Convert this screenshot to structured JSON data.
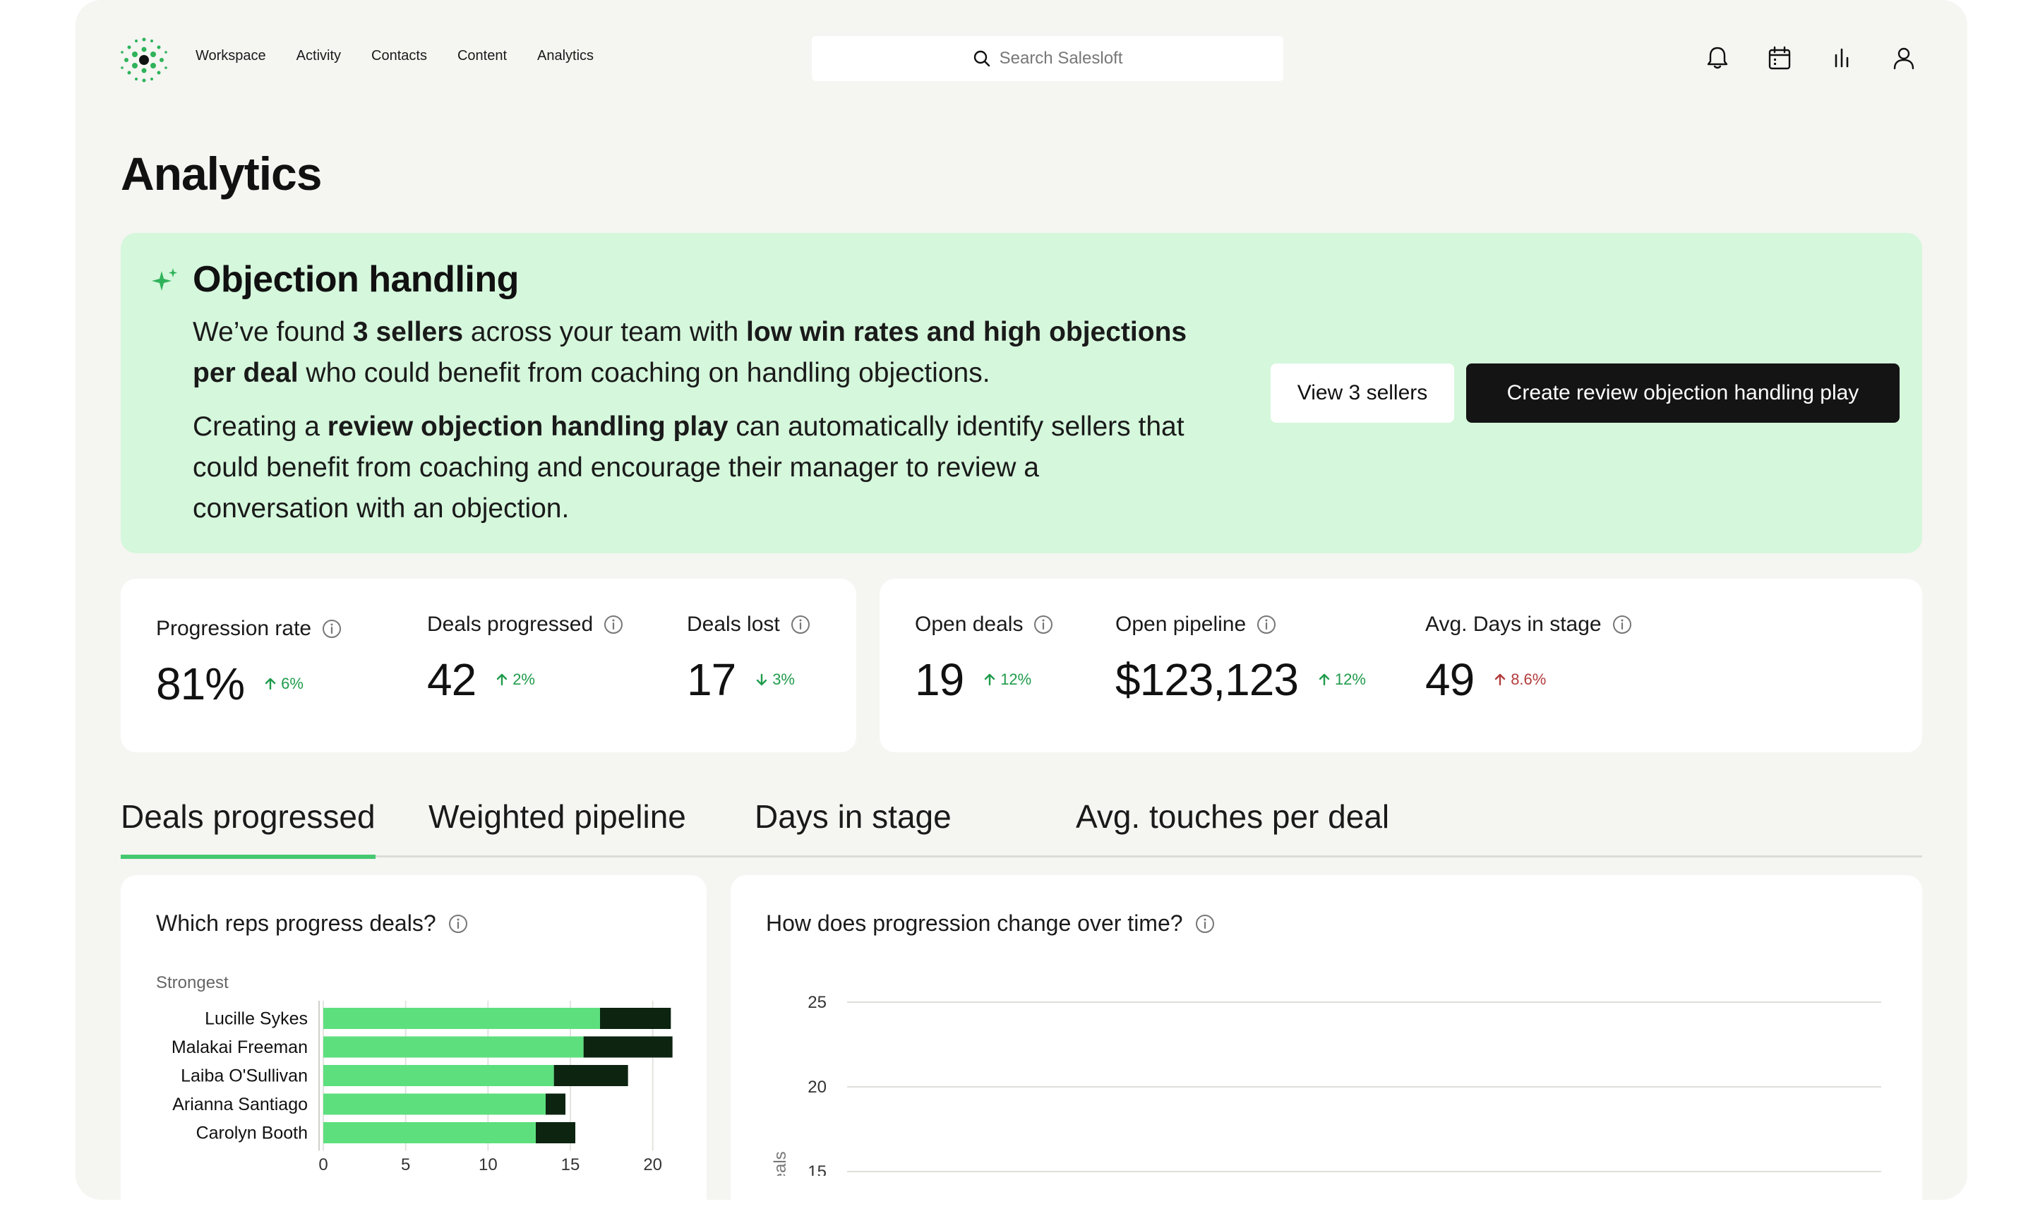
{
  "nav": {
    "items": [
      "Workspace",
      "Activity",
      "Contacts",
      "Content",
      "Analytics"
    ]
  },
  "search": {
    "placeholder": "Search Salesloft"
  },
  "header_icons": [
    "bell-icon",
    "calendar-icon",
    "bar-chart-icon",
    "user-icon"
  ],
  "page": {
    "title": "Analytics"
  },
  "insight": {
    "title": "Objection handling",
    "p1": {
      "t1": "We’ve found ",
      "b1": "3 sellers",
      "t2": " across your team with ",
      "b2": "low win rates and high objections per deal",
      "t3": " who could benefit from coaching on handling objections."
    },
    "p2": {
      "t1": "Creating a ",
      "b1": "review objection handling play",
      "t2": " can automatically identify sellers that could benefit from coaching and encourage their manager to review a conversation with an objection."
    },
    "view_button": "View 3 sellers",
    "create_button": "Create review objection handling play"
  },
  "metrics_a": [
    {
      "label": "Progression rate",
      "value": "81%",
      "delta": "6%",
      "direction": "up"
    },
    {
      "label": "Deals progressed",
      "value": "42",
      "delta": "2%",
      "direction": "up"
    },
    {
      "label": "Deals lost",
      "value": "17",
      "delta": "3%",
      "direction": "down"
    }
  ],
  "metrics_b": [
    {
      "label": "Open deals",
      "value": "19",
      "delta": "12%",
      "direction": "up"
    },
    {
      "label": "Open pipeline",
      "value": "$123,123",
      "delta": "12%",
      "direction": "up"
    },
    {
      "label": "Avg. Days in stage",
      "value": "49",
      "delta": "8.6%",
      "direction": "up-negative"
    }
  ],
  "tabs": [
    {
      "label": "Deals progressed",
      "active": true
    },
    {
      "label": "Weighted pipeline",
      "active": false
    },
    {
      "label": "Days in stage",
      "active": false
    },
    {
      "label": "Avg. touches per deal",
      "active": false
    }
  ],
  "colors": {
    "accent_green": "#5ddf7e",
    "dark_green": "#0c2410",
    "delta_up": "#1f9b4b",
    "delta_bad": "#b23b3b",
    "banner_bg": "#d5f7dc"
  },
  "chart_data": [
    {
      "type": "bar",
      "title": "Which reps progress deals?",
      "group_label": "Strongest",
      "categories": [
        "Lucille Sykes",
        "Malakai Freeman",
        "Laiba O'Sullivan",
        "Arianna Santiago",
        "Carolyn Booth"
      ],
      "series": [
        {
          "color": "#5ddf7e",
          "values": [
            16.8,
            15.8,
            14.0,
            13.5,
            12.9
          ]
        },
        {
          "color": "#0c2410",
          "values": [
            4.3,
            5.4,
            4.5,
            1.2,
            2.4
          ]
        }
      ],
      "stacked": true,
      "orientation": "horizontal",
      "xlim": [
        0,
        21
      ],
      "xticks": [
        "0",
        "5",
        "10",
        "15",
        "20"
      ],
      "grid": true
    },
    {
      "type": "line",
      "title": "How does progression change over time?",
      "ylabel": "deals",
      "yticks": [
        "25",
        "20",
        "15"
      ],
      "ylim": [
        15,
        25
      ],
      "grid": true
    }
  ]
}
